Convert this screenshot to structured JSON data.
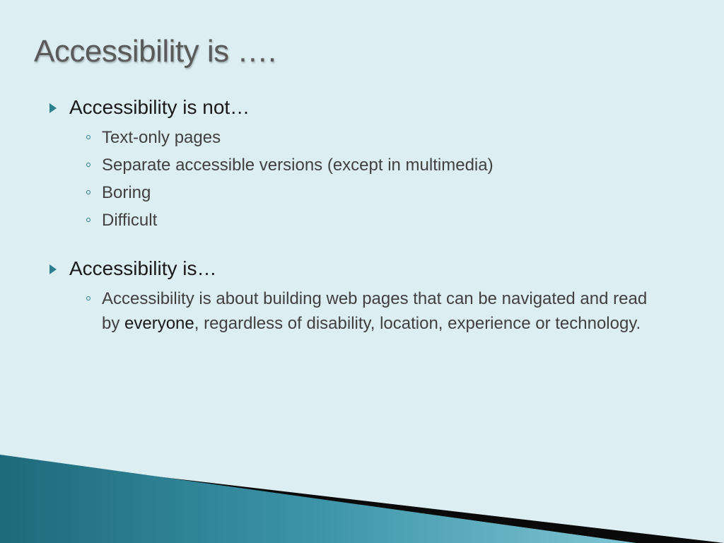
{
  "slide": {
    "title": "Accessibility is ….",
    "section1": {
      "heading": "Accessibility is not…",
      "items": [
        "Text-only pages",
        "Separate accessible versions (except in multimedia)",
        "Boring",
        "Difficult"
      ]
    },
    "section2": {
      "heading": "Accessibility is…",
      "paragraph_before": "Accessibility is about building web pages that can be navigated and read by ",
      "paragraph_bold": "everyone",
      "paragraph_after": ", regardless of disability, location, experience or technology."
    }
  }
}
